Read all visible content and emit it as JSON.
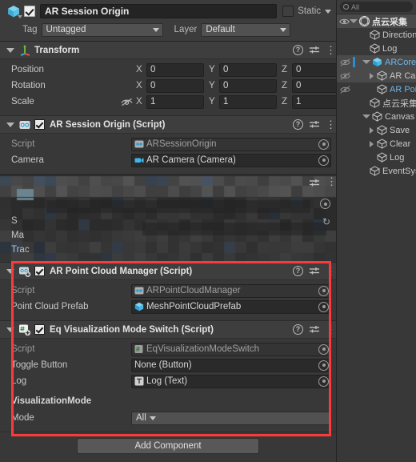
{
  "colors": {
    "accent_blue": "#4ec3f0",
    "highlight_red": "#fb3b3b",
    "panel_bg": "#383838",
    "header_bg": "#3e3e3e",
    "field_bg": "#2a2a2a",
    "selected_row": "#4a4a4a",
    "link_blue": "#6fb6e8"
  },
  "inspector": {
    "gameobject": {
      "icon": "cube-icon",
      "enabled": true,
      "name": "AR Session Origin",
      "static_checked": false,
      "static_label": "Static",
      "tag_label": "Tag",
      "tag_value": "Untagged",
      "layer_label": "Layer",
      "layer_value": "Default"
    },
    "components": [
      {
        "id": "transform",
        "title": "Transform",
        "icon": "transform-axis-icon",
        "expanded": true,
        "has_checkbox": false,
        "rows": [
          {
            "label": "Position",
            "x": "0",
            "y": "0",
            "z": "0",
            "has_lock": false
          },
          {
            "label": "Rotation",
            "x": "0",
            "y": "0",
            "z": "0",
            "has_lock": false
          },
          {
            "label": "Scale",
            "x": "1",
            "y": "1",
            "z": "1",
            "has_lock": true
          }
        ],
        "axis_labels": [
          "X",
          "Y",
          "Z"
        ]
      },
      {
        "id": "ar-session-origin",
        "title": "AR Session Origin (Script)",
        "icon": "script-icon",
        "expanded": true,
        "has_checkbox": true,
        "checked": true,
        "fields": [
          {
            "label": "Script",
            "readonly": true,
            "icon": "cs-script-icon",
            "value": "ARSessionOrigin",
            "picker": true
          },
          {
            "label": "Camera",
            "readonly": false,
            "icon": "camera-icon",
            "value": "AR Camera (Camera)",
            "picker": true
          }
        ]
      },
      {
        "id": "blurred-component",
        "title": "",
        "blurred": true,
        "partial_labels": [
          "S",
          "Ma",
          "Trac"
        ]
      },
      {
        "id": "ar-point-cloud-manager",
        "title": "AR Point Cloud Manager (Script)",
        "icon": "script-icon",
        "expanded": true,
        "has_checkbox": true,
        "checked": true,
        "highlighted": true,
        "fields": [
          {
            "label": "Script",
            "readonly": true,
            "icon": "cs-script-icon",
            "value": "ARPointCloudManager",
            "picker": true
          },
          {
            "label": "Point Cloud Prefab",
            "readonly": false,
            "icon": "prefab-icon",
            "value": "MeshPointCloudPrefab",
            "picker": true
          }
        ]
      },
      {
        "id": "eq-visualization-mode-switch",
        "title": "Eq Visualization Mode Switch (Script)",
        "icon": "cs-script-green-icon",
        "expanded": true,
        "has_checkbox": true,
        "checked": true,
        "highlighted": true,
        "fields": [
          {
            "label": "Script",
            "readonly": true,
            "icon": "cs-script-icon",
            "value": "EqVisualizationModeSwitch",
            "picker": true
          },
          {
            "label": "Toggle Button",
            "readonly": false,
            "icon": "",
            "value": "None (Button)",
            "picker": true
          },
          {
            "label": "Log",
            "readonly": false,
            "icon": "text-icon",
            "value": "Log (Text)",
            "picker": true
          }
        ],
        "section_header": "VisualizationMode",
        "enum_field": {
          "label": "Mode",
          "value": "All"
        }
      }
    ],
    "header_buttons": {
      "help": "help-icon",
      "preset": "preset-sliders-icon",
      "menu": "kebab-menu-icon"
    },
    "add_component_label": "Add Component"
  },
  "hierarchy": {
    "search_placeholder": "All",
    "scene_name": "点云采集",
    "items": [
      {
        "name": "Directional Light",
        "indent": 1,
        "expandable": false,
        "expanded": false,
        "selected": false,
        "blue": false,
        "vis": false,
        "pipe": false
      },
      {
        "name": "Log",
        "indent": 1,
        "expandable": false,
        "expanded": false,
        "selected": false,
        "blue": false,
        "vis": false,
        "pipe": false
      },
      {
        "name": "ARCore Session Origin",
        "indent": 1,
        "expandable": true,
        "expanded": true,
        "selected": true,
        "blue": true,
        "vis": true,
        "pipe": true
      },
      {
        "name": "AR Camera",
        "indent": 2,
        "expandable": true,
        "expanded": false,
        "selected": true,
        "blue": false,
        "vis": true,
        "pipe": false
      },
      {
        "name": "AR Point Cloud",
        "indent": 2,
        "expandable": false,
        "expanded": false,
        "selected": false,
        "blue": true,
        "vis": true,
        "pipe": false
      },
      {
        "name": "点云采集器",
        "indent": 1,
        "expandable": false,
        "expanded": false,
        "selected": false,
        "blue": false,
        "vis": false,
        "pipe": false
      },
      {
        "name": "Canvas",
        "indent": 1,
        "expandable": true,
        "expanded": true,
        "selected": false,
        "blue": false,
        "vis": false,
        "pipe": false
      },
      {
        "name": "Save",
        "indent": 2,
        "expandable": true,
        "expanded": false,
        "selected": false,
        "blue": false,
        "vis": false,
        "pipe": false
      },
      {
        "name": "Clear",
        "indent": 2,
        "expandable": true,
        "expanded": false,
        "selected": false,
        "blue": false,
        "vis": false,
        "pipe": false
      },
      {
        "name": "Log",
        "indent": 2,
        "expandable": false,
        "expanded": false,
        "selected": false,
        "blue": false,
        "vis": false,
        "pipe": false
      },
      {
        "name": "EventSystem",
        "indent": 1,
        "expandable": false,
        "expanded": false,
        "selected": false,
        "blue": false,
        "vis": false,
        "pipe": false
      }
    ]
  }
}
